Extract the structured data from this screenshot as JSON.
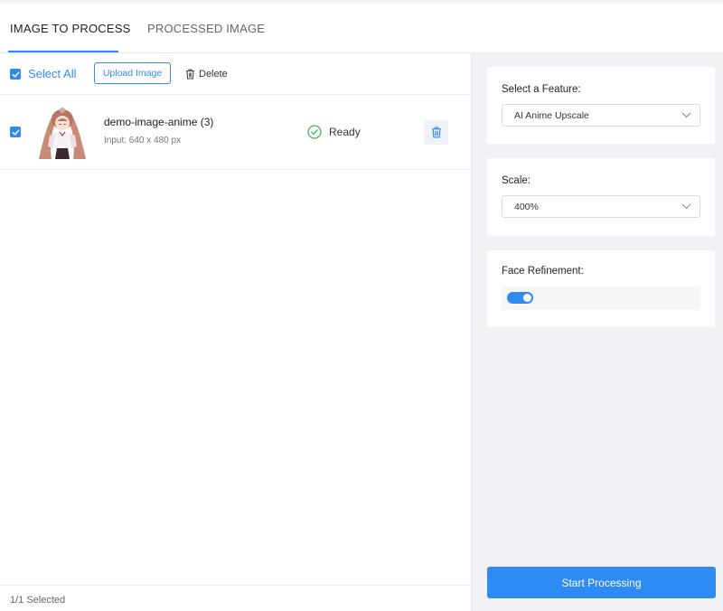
{
  "tabs": {
    "active": "IMAGE TO PROCESS",
    "inactive": "PROCESSED IMAGE"
  },
  "toolbar": {
    "select_all": "Select All",
    "upload": "Upload Image",
    "delete": "Delete"
  },
  "file": {
    "name": "demo-image-anime (3)",
    "meta": "Input: 640 x 480 px",
    "status": "Ready",
    "checked": true
  },
  "footer": {
    "selected": "1/1 Selected"
  },
  "settings": {
    "feature_label": "Select a Feature:",
    "feature_value": "AI Anime Upscale",
    "scale_label": "Scale:",
    "scale_value": "400%",
    "face_label": "Face Refinement:",
    "face_enabled": true
  },
  "actions": {
    "start": "Start Processing"
  },
  "colors": {
    "accent": "#2f8bf3",
    "ready": "#3cb54a",
    "panel_bg": "#f0f2f5"
  },
  "icons": {
    "checkbox": "check-icon",
    "delete": "trash-icon",
    "status": "check-circle-icon",
    "select": "chevron-down-icon"
  }
}
